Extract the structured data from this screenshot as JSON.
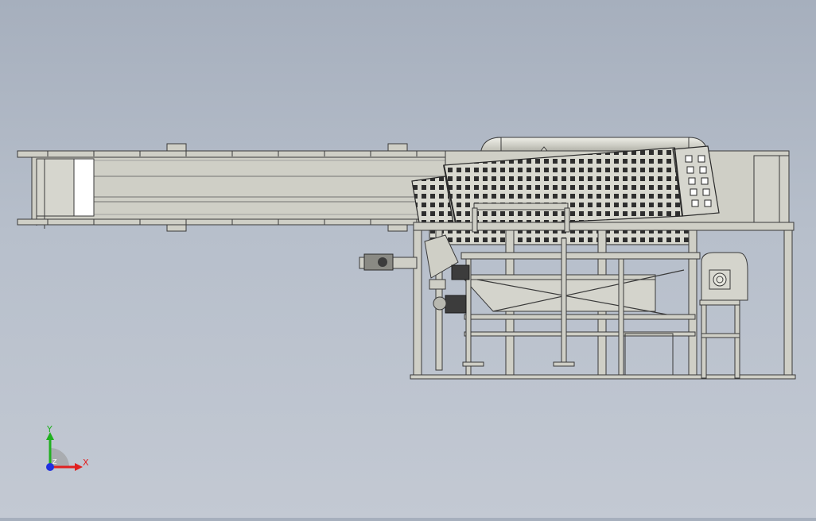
{
  "viewport": {
    "background_top": "#a6afbd",
    "background_bottom": "#c3c9d3"
  },
  "model": {
    "part_color": "#cfcfc6",
    "edge_color": "#3a3a3a",
    "panel_white": "#ffffff",
    "motor_color": "#3c3c3c",
    "drum_color": "#d8d8cf"
  },
  "triad": {
    "x_label": "X",
    "y_label": "Y",
    "z_label": "Z",
    "x_color": "#e02020",
    "y_color": "#20b020",
    "z_color": "#2030e0"
  }
}
